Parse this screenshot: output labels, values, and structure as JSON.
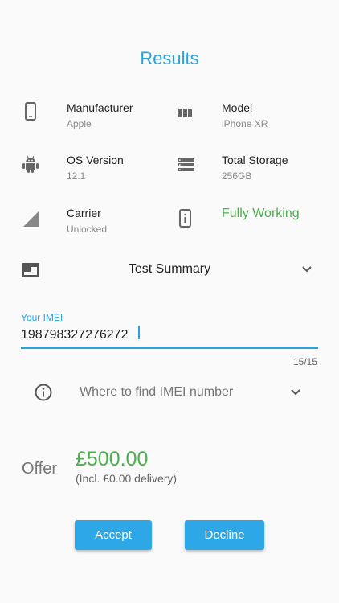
{
  "header": {
    "title": "Results"
  },
  "device": {
    "manufacturer": {
      "label": "Manufacturer",
      "value": "Apple",
      "icon": "phone-icon"
    },
    "model": {
      "label": "Model",
      "value": "iPhone XR",
      "icon": "grid-icon"
    },
    "os_version": {
      "label": "OS Version",
      "value": "12.1",
      "icon": "android-icon"
    },
    "total_storage": {
      "label": "Total Storage",
      "value": "256GB",
      "icon": "storage-icon"
    },
    "carrier": {
      "label": "Carrier",
      "value": "Unlocked",
      "icon": "signal-icon"
    },
    "status": {
      "label": "Fully Working",
      "icon": "info-phone-icon"
    }
  },
  "summary": {
    "label": "Test Summary",
    "icon": "summary-icon"
  },
  "imei": {
    "label": "Your IMEI",
    "value": "198798327276272",
    "counter": "15/15"
  },
  "find_imei": {
    "label": "Where to find IMEI number",
    "icon": "info-icon"
  },
  "offer": {
    "label": "Offer",
    "price": "£500.00",
    "note": "(Incl. £0.00 delivery)"
  },
  "actions": {
    "accept": "Accept",
    "decline": "Decline"
  },
  "colors": {
    "accent": "#29a3e0",
    "success": "#4caf50",
    "button": "#2ea7e6",
    "icon": "#666666"
  }
}
